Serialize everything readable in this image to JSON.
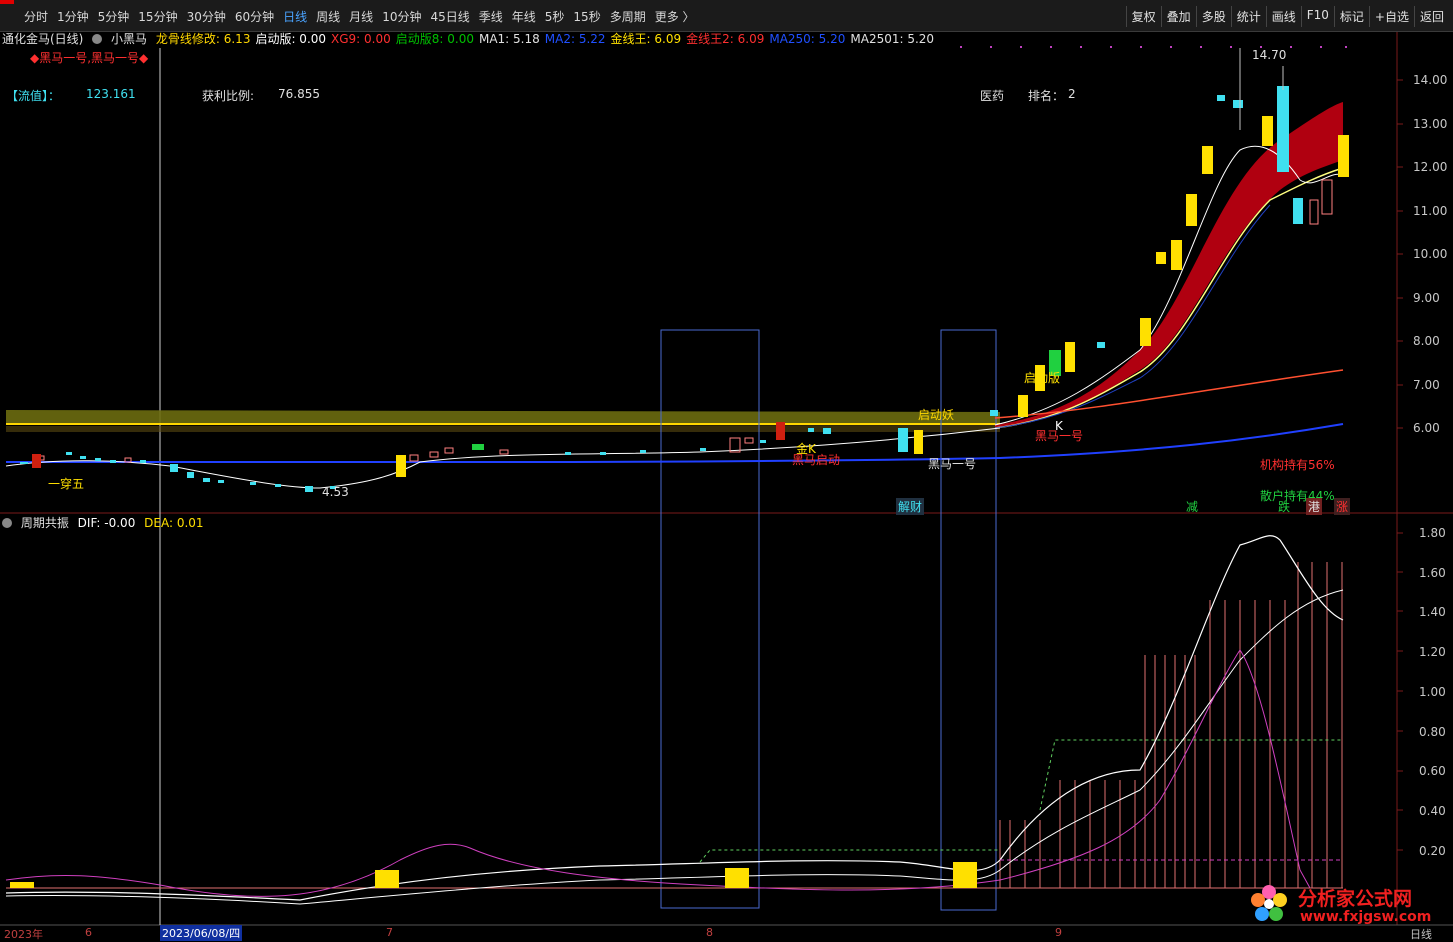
{
  "toolbar": {
    "tabs": [
      "分时",
      "1分钟",
      "5分钟",
      "15分钟",
      "30分钟",
      "60分钟",
      "日线",
      "周线",
      "月线",
      "10分钟",
      "45日线",
      "季线",
      "年线",
      "5秒",
      "15秒",
      "多周期",
      "更多 〉"
    ],
    "active_tab": "日线",
    "tools": [
      "复权",
      "叠加",
      "多股",
      "统计",
      "画线",
      "F10",
      "标记",
      "+自选",
      "返回"
    ]
  },
  "main_header": {
    "stock": "通化金马(日线)",
    "indicator": "小黑马",
    "items": [
      {
        "text": "龙骨线修改: 6.13",
        "color": "#ffd700"
      },
      {
        "text": "启动版: 0.00",
        "color": "#ffffff"
      },
      {
        "text": "XG9: 0.00",
        "color": "#ff3030"
      },
      {
        "text": "启动版8: 0.00",
        "color": "#00c000"
      },
      {
        "text": "MA1: 5.18",
        "color": "#e0e0e0"
      },
      {
        "text": "MA2: 5.22",
        "color": "#2050ff"
      },
      {
        "text": "金线王: 6.09",
        "color": "#ffe000"
      },
      {
        "text": "金线王2: 6.09",
        "color": "#ff3030"
      },
      {
        "text": "MA250: 5.20",
        "color": "#2050ff"
      },
      {
        "text": "MA2501: 5.20",
        "color": "#e0e0e0"
      }
    ]
  },
  "signal_text": "◆黑马一号,黑马一号◆",
  "info": {
    "liuzhi_label": "【流值】：",
    "liuzhi_value": "123.161",
    "profit_label": "获利比例:",
    "profit_value": "76.855",
    "sector": "医药",
    "rank_label": "排名：",
    "rank_value": "2"
  },
  "annotations": {
    "high_price": "14.70",
    "low_price": "4.53",
    "yi_chuan_wu": "一穿五",
    "qidong_yao": "启动妖",
    "qidong_ban": "启动版",
    "heima_yihao": "黑马一号",
    "heima_hao": "黑马一号",
    "jinK": "金K",
    "k": "K",
    "heima_qidong": "黑马启动",
    "jigou": "机构持有56%",
    "sanhu": "散户持有44%",
    "jiecai": "解财",
    "jian": "减",
    "die": "跌",
    "gang": "港",
    "zhang": "涨"
  },
  "price_axis": [
    "14.00",
    "13.00",
    "12.00",
    "11.00",
    "10.00",
    "9.00",
    "8.00",
    "7.00",
    "6.00"
  ],
  "sub_header": {
    "name": "周期共振",
    "dif": "DIF: -0.00",
    "dea": "DEA: 0.01"
  },
  "sub_axis": [
    "1.80",
    "1.60",
    "1.40",
    "1.20",
    "1.00",
    "0.80",
    "0.60",
    "0.40",
    "0.20"
  ],
  "dates": {
    "year": "2023年",
    "m6": "6",
    "cursor": "2023/06/08/四",
    "m7": "7",
    "m8": "8",
    "m9": "9",
    "right": "日线"
  },
  "watermark": {
    "text": "分析家公式网",
    "url": "www.fxjgsw.com"
  }
}
